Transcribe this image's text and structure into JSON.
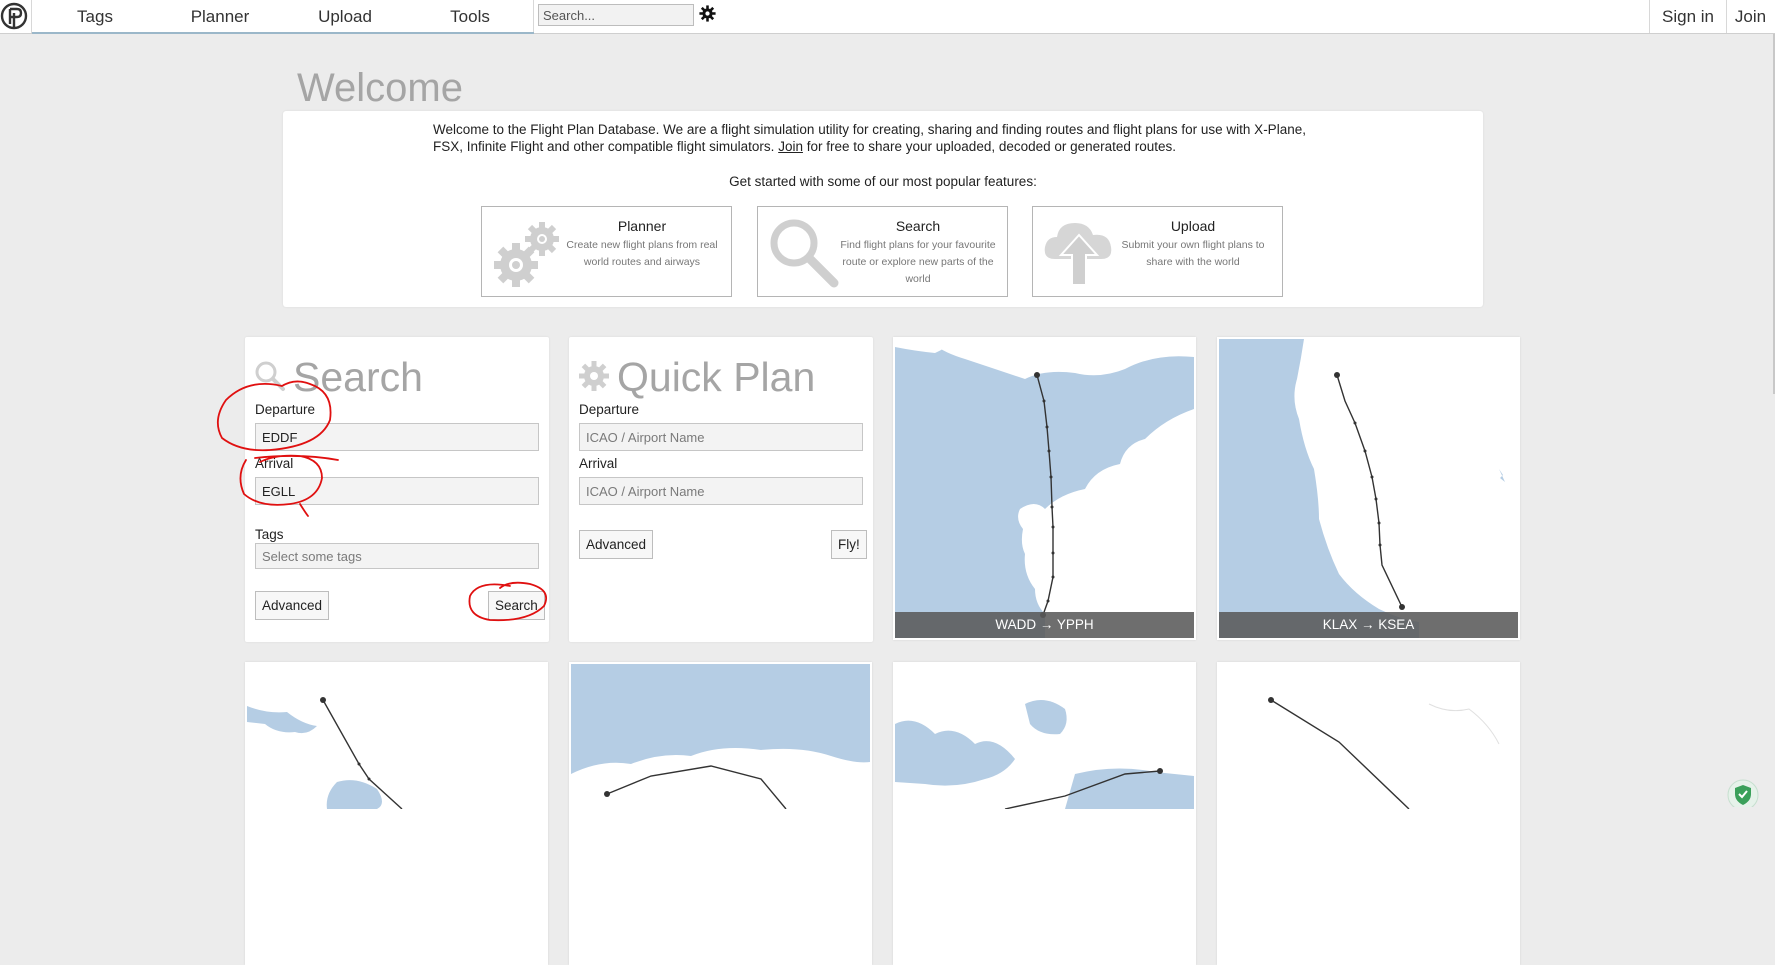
{
  "nav": {
    "items": [
      {
        "label": "Tags"
      },
      {
        "label": "Planner"
      },
      {
        "label": "Upload"
      },
      {
        "label": "Tools"
      }
    ],
    "search_placeholder": "Search...",
    "sign_in": "Sign in",
    "join": "Join"
  },
  "welcome": {
    "title": "Welcome",
    "intro_before_link": "Welcome to the Flight Plan Database. We are a flight simulation utility for creating, sharing and finding routes and flight plans for use with X-Plane, FSX, Infinite Flight and other compatible flight simulators.",
    "intro_link": "Join",
    "intro_after_link": "for free to share your uploaded, decoded or generated routes.",
    "get_started": "Get started with some of our most popular features:",
    "features": [
      {
        "title": "Planner",
        "description": "Create new flight plans from real world routes and airways",
        "icon": "gears-icon"
      },
      {
        "title": "Search",
        "description": "Find flight plans for your favourite route or explore new parts of the world",
        "icon": "magnifier-icon"
      },
      {
        "title": "Upload",
        "description": "Submit your own flight plans to share with the world",
        "icon": "cloud-upload-icon"
      }
    ]
  },
  "search_panel": {
    "title": "Search",
    "departure_label": "Departure",
    "departure_value": "EDDF",
    "arrival_label": "Arrival",
    "arrival_value": "EGLL",
    "tags_label": "Tags",
    "tags_placeholder": "Select some tags",
    "advanced": "Advanced",
    "search": "Search"
  },
  "quick_plan": {
    "title": "Quick Plan",
    "departure_label": "Departure",
    "departure_placeholder": "ICAO / Airport Name",
    "arrival_label": "Arrival",
    "arrival_placeholder": "ICAO / Airport Name",
    "advanced": "Advanced",
    "fly": "Fly!"
  },
  "routes": [
    {
      "caption": "WADD → YPPH"
    },
    {
      "caption": "KLAX → KSEA"
    }
  ],
  "colors": {
    "water": "#b5cde4",
    "land": "#ffffff",
    "annotation": "#e01010"
  }
}
